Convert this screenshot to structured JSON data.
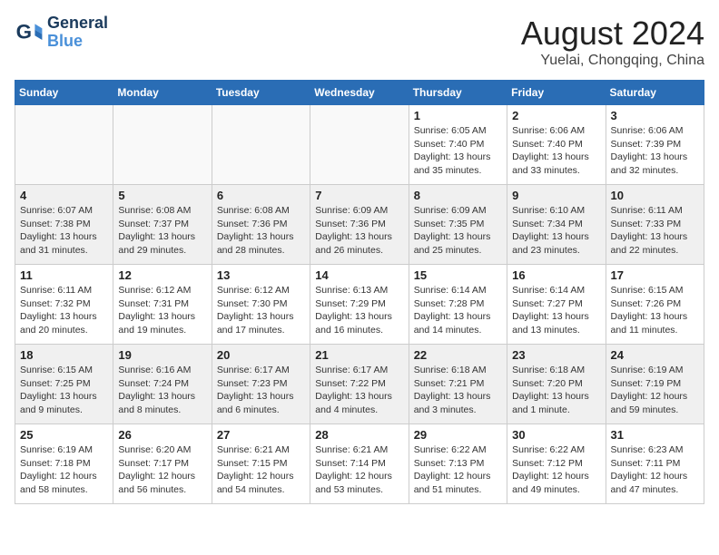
{
  "header": {
    "logo_line1": "General",
    "logo_line2": "Blue",
    "month_year": "August 2024",
    "location": "Yuelai, Chongqing, China"
  },
  "weekdays": [
    "Sunday",
    "Monday",
    "Tuesday",
    "Wednesday",
    "Thursday",
    "Friday",
    "Saturday"
  ],
  "weeks": [
    [
      {
        "day": "",
        "info": ""
      },
      {
        "day": "",
        "info": ""
      },
      {
        "day": "",
        "info": ""
      },
      {
        "day": "",
        "info": ""
      },
      {
        "day": "1",
        "info": "Sunrise: 6:05 AM\nSunset: 7:40 PM\nDaylight: 13 hours\nand 35 minutes."
      },
      {
        "day": "2",
        "info": "Sunrise: 6:06 AM\nSunset: 7:40 PM\nDaylight: 13 hours\nand 33 minutes."
      },
      {
        "day": "3",
        "info": "Sunrise: 6:06 AM\nSunset: 7:39 PM\nDaylight: 13 hours\nand 32 minutes."
      }
    ],
    [
      {
        "day": "4",
        "info": "Sunrise: 6:07 AM\nSunset: 7:38 PM\nDaylight: 13 hours\nand 31 minutes."
      },
      {
        "day": "5",
        "info": "Sunrise: 6:08 AM\nSunset: 7:37 PM\nDaylight: 13 hours\nand 29 minutes."
      },
      {
        "day": "6",
        "info": "Sunrise: 6:08 AM\nSunset: 7:36 PM\nDaylight: 13 hours\nand 28 minutes."
      },
      {
        "day": "7",
        "info": "Sunrise: 6:09 AM\nSunset: 7:36 PM\nDaylight: 13 hours\nand 26 minutes."
      },
      {
        "day": "8",
        "info": "Sunrise: 6:09 AM\nSunset: 7:35 PM\nDaylight: 13 hours\nand 25 minutes."
      },
      {
        "day": "9",
        "info": "Sunrise: 6:10 AM\nSunset: 7:34 PM\nDaylight: 13 hours\nand 23 minutes."
      },
      {
        "day": "10",
        "info": "Sunrise: 6:11 AM\nSunset: 7:33 PM\nDaylight: 13 hours\nand 22 minutes."
      }
    ],
    [
      {
        "day": "11",
        "info": "Sunrise: 6:11 AM\nSunset: 7:32 PM\nDaylight: 13 hours\nand 20 minutes."
      },
      {
        "day": "12",
        "info": "Sunrise: 6:12 AM\nSunset: 7:31 PM\nDaylight: 13 hours\nand 19 minutes."
      },
      {
        "day": "13",
        "info": "Sunrise: 6:12 AM\nSunset: 7:30 PM\nDaylight: 13 hours\nand 17 minutes."
      },
      {
        "day": "14",
        "info": "Sunrise: 6:13 AM\nSunset: 7:29 PM\nDaylight: 13 hours\nand 16 minutes."
      },
      {
        "day": "15",
        "info": "Sunrise: 6:14 AM\nSunset: 7:28 PM\nDaylight: 13 hours\nand 14 minutes."
      },
      {
        "day": "16",
        "info": "Sunrise: 6:14 AM\nSunset: 7:27 PM\nDaylight: 13 hours\nand 13 minutes."
      },
      {
        "day": "17",
        "info": "Sunrise: 6:15 AM\nSunset: 7:26 PM\nDaylight: 13 hours\nand 11 minutes."
      }
    ],
    [
      {
        "day": "18",
        "info": "Sunrise: 6:15 AM\nSunset: 7:25 PM\nDaylight: 13 hours\nand 9 minutes."
      },
      {
        "day": "19",
        "info": "Sunrise: 6:16 AM\nSunset: 7:24 PM\nDaylight: 13 hours\nand 8 minutes."
      },
      {
        "day": "20",
        "info": "Sunrise: 6:17 AM\nSunset: 7:23 PM\nDaylight: 13 hours\nand 6 minutes."
      },
      {
        "day": "21",
        "info": "Sunrise: 6:17 AM\nSunset: 7:22 PM\nDaylight: 13 hours\nand 4 minutes."
      },
      {
        "day": "22",
        "info": "Sunrise: 6:18 AM\nSunset: 7:21 PM\nDaylight: 13 hours\nand 3 minutes."
      },
      {
        "day": "23",
        "info": "Sunrise: 6:18 AM\nSunset: 7:20 PM\nDaylight: 13 hours\nand 1 minute."
      },
      {
        "day": "24",
        "info": "Sunrise: 6:19 AM\nSunset: 7:19 PM\nDaylight: 12 hours\nand 59 minutes."
      }
    ],
    [
      {
        "day": "25",
        "info": "Sunrise: 6:19 AM\nSunset: 7:18 PM\nDaylight: 12 hours\nand 58 minutes."
      },
      {
        "day": "26",
        "info": "Sunrise: 6:20 AM\nSunset: 7:17 PM\nDaylight: 12 hours\nand 56 minutes."
      },
      {
        "day": "27",
        "info": "Sunrise: 6:21 AM\nSunset: 7:15 PM\nDaylight: 12 hours\nand 54 minutes."
      },
      {
        "day": "28",
        "info": "Sunrise: 6:21 AM\nSunset: 7:14 PM\nDaylight: 12 hours\nand 53 minutes."
      },
      {
        "day": "29",
        "info": "Sunrise: 6:22 AM\nSunset: 7:13 PM\nDaylight: 12 hours\nand 51 minutes."
      },
      {
        "day": "30",
        "info": "Sunrise: 6:22 AM\nSunset: 7:12 PM\nDaylight: 12 hours\nand 49 minutes."
      },
      {
        "day": "31",
        "info": "Sunrise: 6:23 AM\nSunset: 7:11 PM\nDaylight: 12 hours\nand 47 minutes."
      }
    ]
  ]
}
